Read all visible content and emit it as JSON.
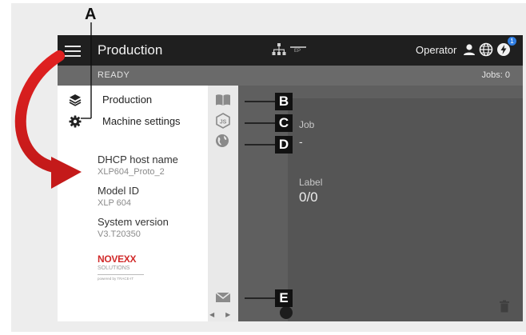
{
  "header": {
    "title": "Production",
    "ep_label": "EP",
    "role": "Operator",
    "notification_count": "1"
  },
  "status": {
    "state": "READY",
    "jobs": "Jobs: 0"
  },
  "side_menu": {
    "items": [
      {
        "label": "Production",
        "icon": "layers-icon"
      },
      {
        "label": "Machine settings",
        "icon": "gear-icon"
      }
    ],
    "info": [
      {
        "label": "DHCP host name",
        "value": "XLP604_Proto_2"
      },
      {
        "label": "Model ID",
        "value": "XLP 604"
      },
      {
        "label": "System version",
        "value": "V3.T20350"
      }
    ],
    "logo": {
      "name": "NOVEXX",
      "sub": "SOLUTIONS",
      "powered": "powered by TRACE-IT"
    }
  },
  "icon_rail": {
    "icons": [
      "book-icon",
      "nodejs-icon",
      "globe-icon",
      "mail-icon"
    ]
  },
  "main": {
    "job_label": "Job",
    "job_value": "-",
    "label_label": "Label",
    "label_value": "0/0"
  },
  "callouts": {
    "a": "A",
    "b": "B",
    "c": "C",
    "d": "D",
    "e": "E"
  },
  "colors": {
    "topbar": "#1f1f1f",
    "statusbar": "#6a6a6a",
    "main_panel": "#5f5f5f",
    "arrow_red": "#e02020",
    "badge_blue": "#2f7de1",
    "logo_red": "#d12a2a"
  }
}
